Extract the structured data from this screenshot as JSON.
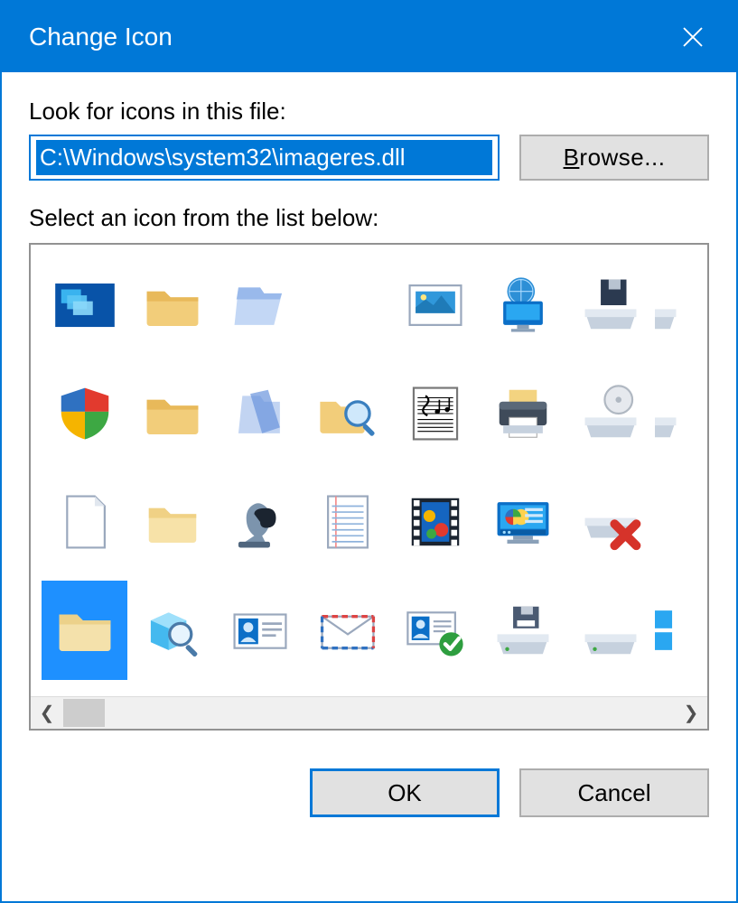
{
  "title": "Change Icon",
  "labels": {
    "look_for": "Look for icons in this file:",
    "select_from": "Select an icon from the list below:"
  },
  "path": "C:\\Windows\\system32\\imageres.dll",
  "buttons": {
    "browse": "Browse...",
    "ok": "OK",
    "cancel": "Cancel"
  },
  "selected_index": 21,
  "icons": [
    "desktop-thumbnails-icon",
    "folder-icon",
    "folder-open-glass-icon",
    "",
    "picture-icon",
    "monitor-globe-icon",
    "drive-floppy-icon",
    "drive-partial-icon",
    "security-shield-icon",
    "folder-icon",
    "folder-blue-glass-icon",
    "folder-search-icon",
    "music-sheet-icon",
    "printer-icon",
    "disc-drive-icon",
    "drive-partial-2-icon",
    "blank-document-icon",
    "folder-light-icon",
    "chess-games-icon",
    "notepad-lines-icon",
    "video-film-icon",
    "control-panel-icon",
    "drive-error-icon",
    "",
    "folder-selected-icon",
    "search-cube-icon",
    "contact-card-icon",
    "mail-envelope-icon",
    "contact-card-ok-icon",
    "save-floppy-icon",
    "drive-icon",
    "windows-partial-icon"
  ]
}
